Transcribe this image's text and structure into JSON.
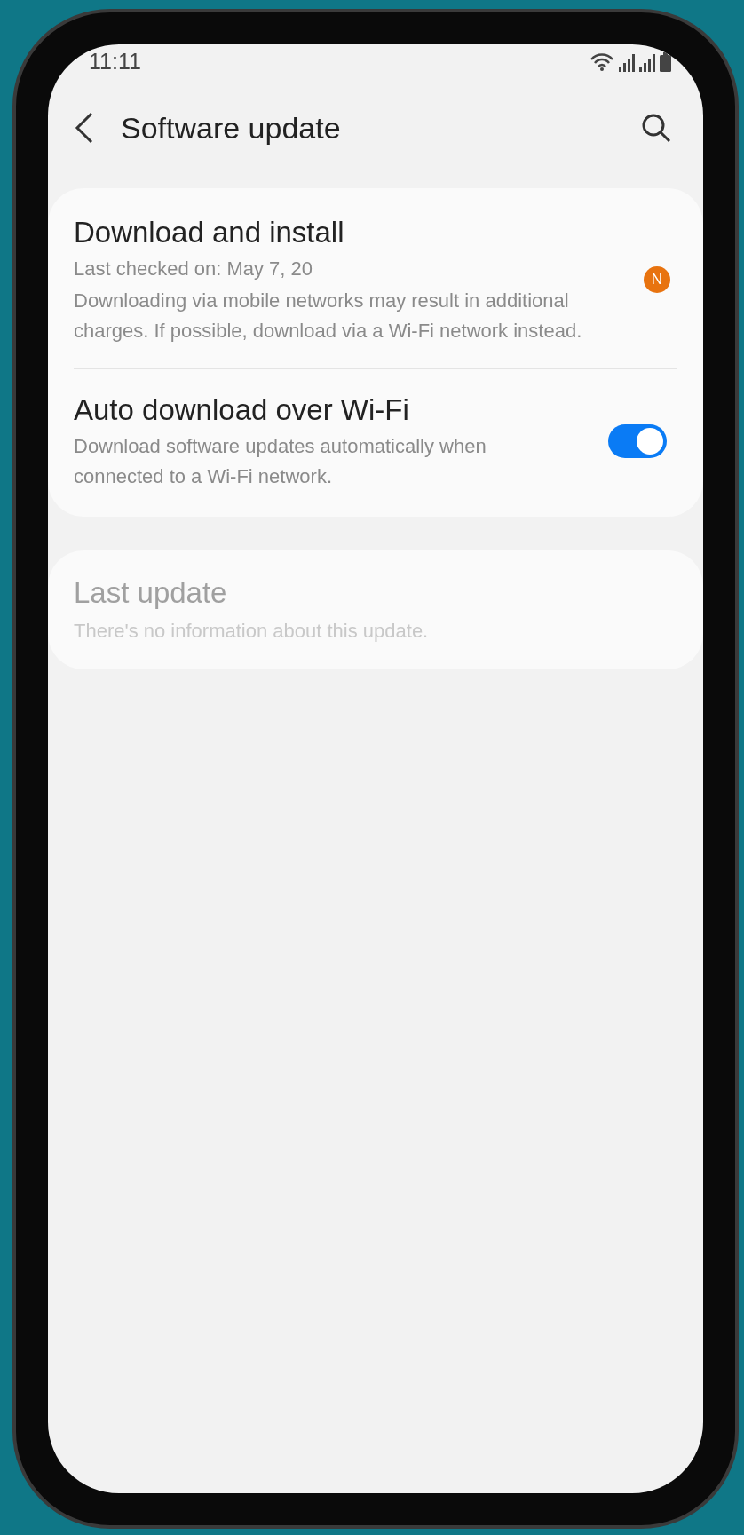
{
  "status_bar": {
    "time": "11:11"
  },
  "header": {
    "title": "Software update"
  },
  "settings_card": [
    {
      "kind": "badge",
      "title": "Download and install",
      "description": "Last checked on: May 7, 20",
      "note": "Downloading via mobile networks may result in additional charges. If possible, download via a Wi-Fi network instead.",
      "badge": "N",
      "disabled": false
    },
    {
      "kind": "toggle",
      "title": "Auto download over Wi-Fi",
      "description": "Download software updates automatically when connected to a Wi-Fi network.",
      "on": true,
      "disabled": false
    }
  ],
  "last_update_card": {
    "title": "Last update",
    "description": "There's no information about this update.",
    "disabled": true
  }
}
